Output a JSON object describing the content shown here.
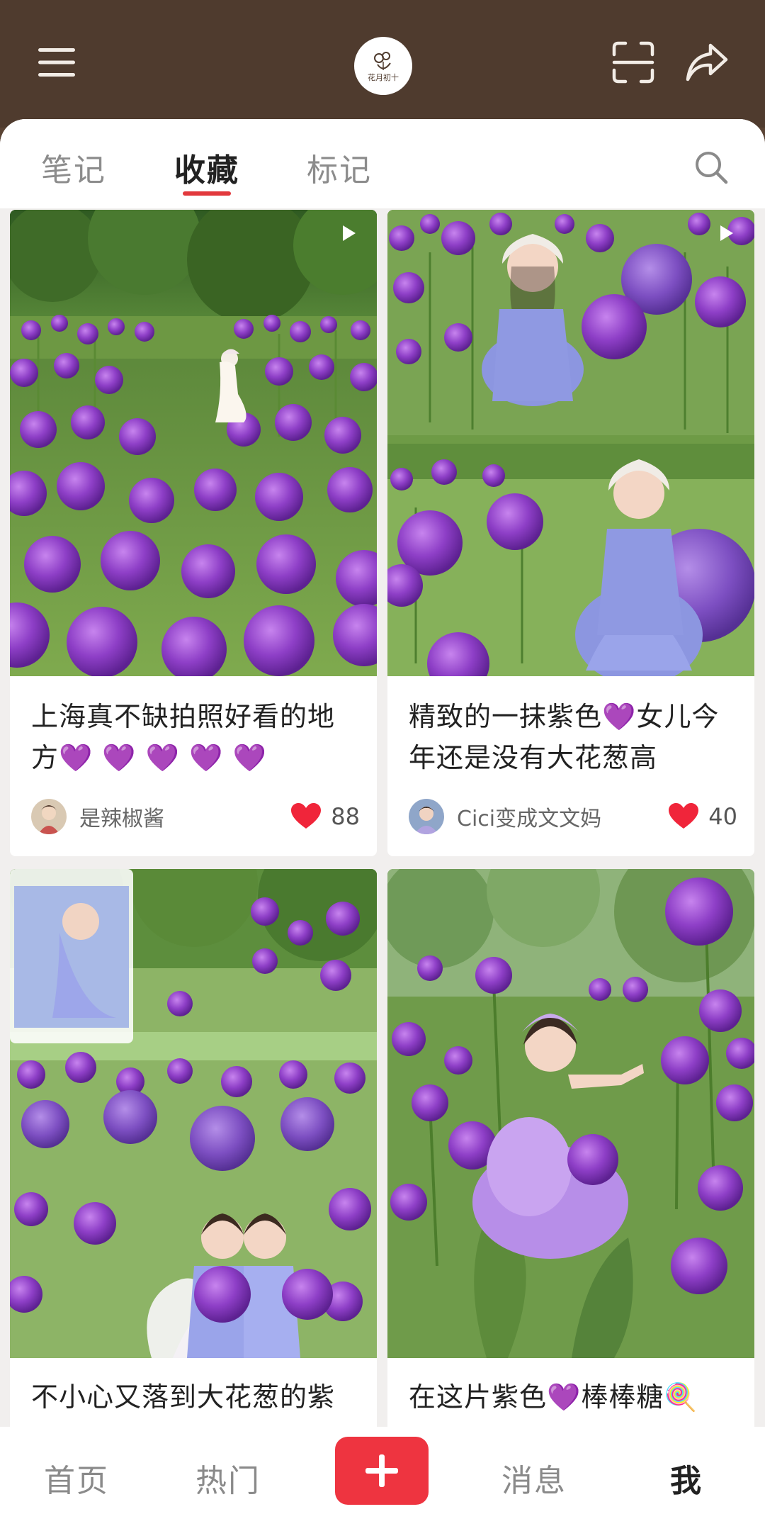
{
  "header": {
    "menu_icon": "hamburger-menu-icon",
    "logo_text": "花月初十",
    "scan_icon": "scan-icon",
    "share_icon": "share-icon"
  },
  "tabs": [
    {
      "label": "笔记",
      "active": false
    },
    {
      "label": "收藏",
      "active": true
    },
    {
      "label": "标记",
      "active": false
    }
  ],
  "search_icon": "search-icon",
  "colors": {
    "header_bg": "#4f3b2e",
    "accent_red": "#e2393d",
    "flower_purple": "#8e3fc7",
    "heart_red": "#f0253a"
  },
  "cards": [
    {
      "title": "上海真不缺拍照好看的地方💜 💜 💜 💜 💜",
      "author": "是辣椒酱",
      "likes": "88",
      "video": true
    },
    {
      "title": "精致的一抹紫色💜女儿今年还是没有大花葱高",
      "author": "Cici变成文文妈",
      "likes": "40",
      "video": true
    },
    {
      "title": "不小心又落到大花葱的紫",
      "video": false
    },
    {
      "title": "在这片紫色💜棒棒糖🍭",
      "video": false
    }
  ],
  "bottom_nav": {
    "home": "首页",
    "hot": "热门",
    "add_icon": "plus-icon",
    "messages": "消息",
    "me": "我"
  }
}
